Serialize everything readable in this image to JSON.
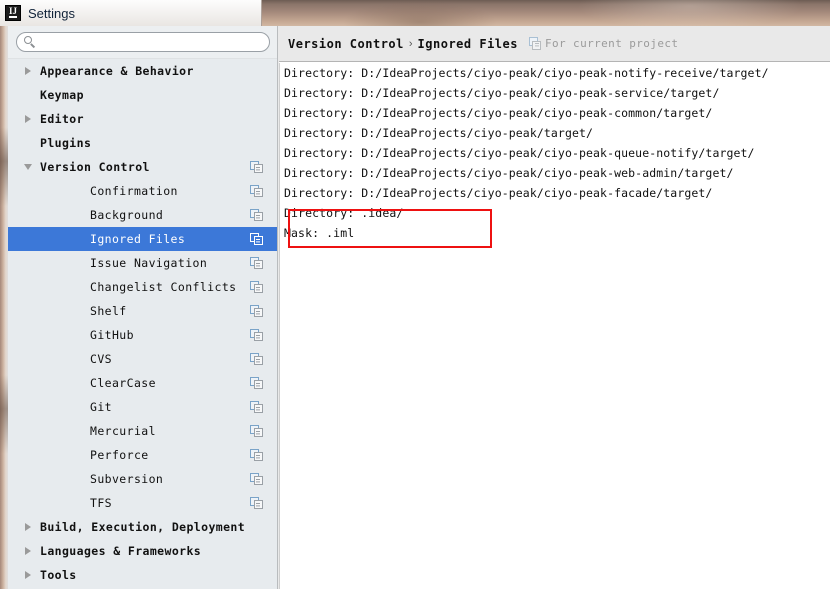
{
  "window": {
    "title": "Settings",
    "app_icon": "intellij-idea-icon",
    "logo_letters": "IJ"
  },
  "sidebar": {
    "search": {
      "value": "",
      "placeholder": "",
      "icon": "search-icon"
    },
    "items": [
      {
        "label": "Appearance & Behavior",
        "level": 0,
        "twisty": "right",
        "scope_icon": false,
        "selected": false
      },
      {
        "label": "Keymap",
        "level": 0,
        "twisty": "none",
        "scope_icon": false,
        "selected": false
      },
      {
        "label": "Editor",
        "level": 0,
        "twisty": "right",
        "scope_icon": false,
        "selected": false
      },
      {
        "label": "Plugins",
        "level": 0,
        "twisty": "none",
        "scope_icon": false,
        "selected": false
      },
      {
        "label": "Version Control",
        "level": 0,
        "twisty": "down",
        "scope_icon": true,
        "selected": false
      },
      {
        "label": "Confirmation",
        "level": 1,
        "twisty": "none",
        "scope_icon": true,
        "selected": false
      },
      {
        "label": "Background",
        "level": 1,
        "twisty": "none",
        "scope_icon": true,
        "selected": false
      },
      {
        "label": "Ignored Files",
        "level": 1,
        "twisty": "none",
        "scope_icon": true,
        "selected": true
      },
      {
        "label": "Issue Navigation",
        "level": 1,
        "twisty": "none",
        "scope_icon": true,
        "selected": false
      },
      {
        "label": "Changelist Conflicts",
        "level": 1,
        "twisty": "none",
        "scope_icon": true,
        "selected": false
      },
      {
        "label": "Shelf",
        "level": 1,
        "twisty": "none",
        "scope_icon": true,
        "selected": false
      },
      {
        "label": "GitHub",
        "level": 1,
        "twisty": "none",
        "scope_icon": true,
        "selected": false
      },
      {
        "label": "CVS",
        "level": 1,
        "twisty": "none",
        "scope_icon": true,
        "selected": false
      },
      {
        "label": "ClearCase",
        "level": 1,
        "twisty": "none",
        "scope_icon": true,
        "selected": false
      },
      {
        "label": "Git",
        "level": 1,
        "twisty": "none",
        "scope_icon": true,
        "selected": false
      },
      {
        "label": "Mercurial",
        "level": 1,
        "twisty": "none",
        "scope_icon": true,
        "selected": false
      },
      {
        "label": "Perforce",
        "level": 1,
        "twisty": "none",
        "scope_icon": true,
        "selected": false
      },
      {
        "label": "Subversion",
        "level": 1,
        "twisty": "none",
        "scope_icon": true,
        "selected": false
      },
      {
        "label": "TFS",
        "level": 1,
        "twisty": "none",
        "scope_icon": true,
        "selected": false
      },
      {
        "label": "Build, Execution, Deployment",
        "level": 0,
        "twisty": "right",
        "scope_icon": false,
        "selected": false
      },
      {
        "label": "Languages & Frameworks",
        "level": 0,
        "twisty": "right",
        "scope_icon": false,
        "selected": false
      },
      {
        "label": "Tools",
        "level": 0,
        "twisty": "right",
        "scope_icon": false,
        "selected": false
      }
    ]
  },
  "content": {
    "breadcrumb": {
      "parent": "Version Control",
      "separator": "›",
      "current": "Ignored Files"
    },
    "scope_note": {
      "icon": "project-scope-icon",
      "text": "For current project"
    },
    "ignored_entries": [
      {
        "text": "Directory: D:/IdeaProjects/ciyo-peak/ciyo-peak-notify-receive/target/",
        "highlighted": false
      },
      {
        "text": "Directory: D:/IdeaProjects/ciyo-peak/ciyo-peak-service/target/",
        "highlighted": false
      },
      {
        "text": "Directory: D:/IdeaProjects/ciyo-peak/ciyo-peak-common/target/",
        "highlighted": false
      },
      {
        "text": "Directory: D:/IdeaProjects/ciyo-peak/target/",
        "highlighted": false
      },
      {
        "text": "Directory: D:/IdeaProjects/ciyo-peak/ciyo-peak-queue-notify/target/",
        "highlighted": false
      },
      {
        "text": "Directory: D:/IdeaProjects/ciyo-peak/ciyo-peak-web-admin/target/",
        "highlighted": false
      },
      {
        "text": "Directory: D:/IdeaProjects/ciyo-peak/ciyo-peak-facade/target/",
        "highlighted": false
      },
      {
        "text": "Directory: .idea/",
        "highlighted": true
      },
      {
        "text": "Mask: .iml",
        "highlighted": true
      }
    ]
  },
  "annotation": {
    "color": "#ee1111",
    "shape": "rectangle"
  }
}
